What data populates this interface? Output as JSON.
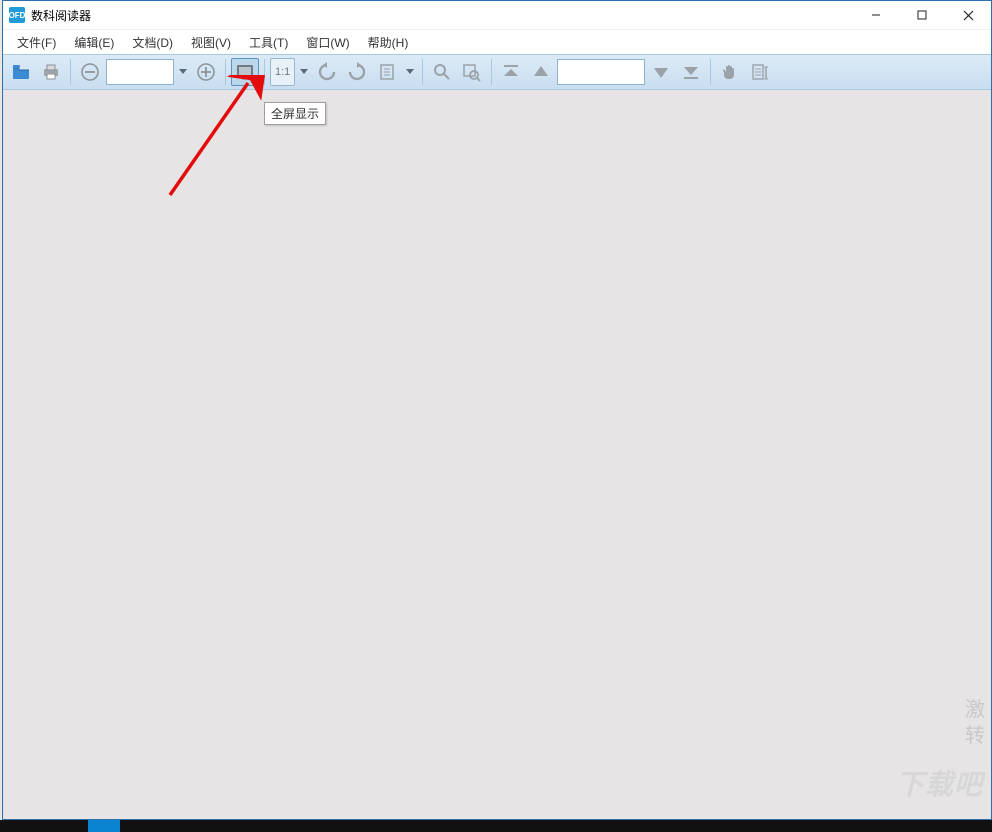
{
  "window": {
    "title": "数科阅读器",
    "icon_label": "OFD"
  },
  "win_controls": {
    "minimize": "最小化",
    "maximize": "最大化",
    "close": "关闭"
  },
  "menus": {
    "file": "文件(F)",
    "edit": "编辑(E)",
    "doc": "文档(D)",
    "view": "视图(V)",
    "tools": "工具(T)",
    "window": "窗口(W)",
    "help": "帮助(H)"
  },
  "toolbar": {
    "open": "打开",
    "print": "打印",
    "zoom_out": "缩小",
    "zoom_level": "",
    "zoom_in": "放大",
    "fullscreen": "全屏显示",
    "actual_size": "1:1",
    "rotate_left": "逆时针旋转",
    "rotate_right": "顺时针旋转",
    "reading_mode": "阅读模式",
    "find": "查找",
    "find_area": "区域查找",
    "first_page": "首页",
    "prev_page": "上一页",
    "page_number": "",
    "next_page": "下一页",
    "last_page": "末页",
    "hand": "手形工具",
    "select_text": "选择文本"
  },
  "tooltip": "全屏显示",
  "watermark": {
    "line1": "激",
    "line2": "转"
  },
  "watermark2": "下载吧"
}
